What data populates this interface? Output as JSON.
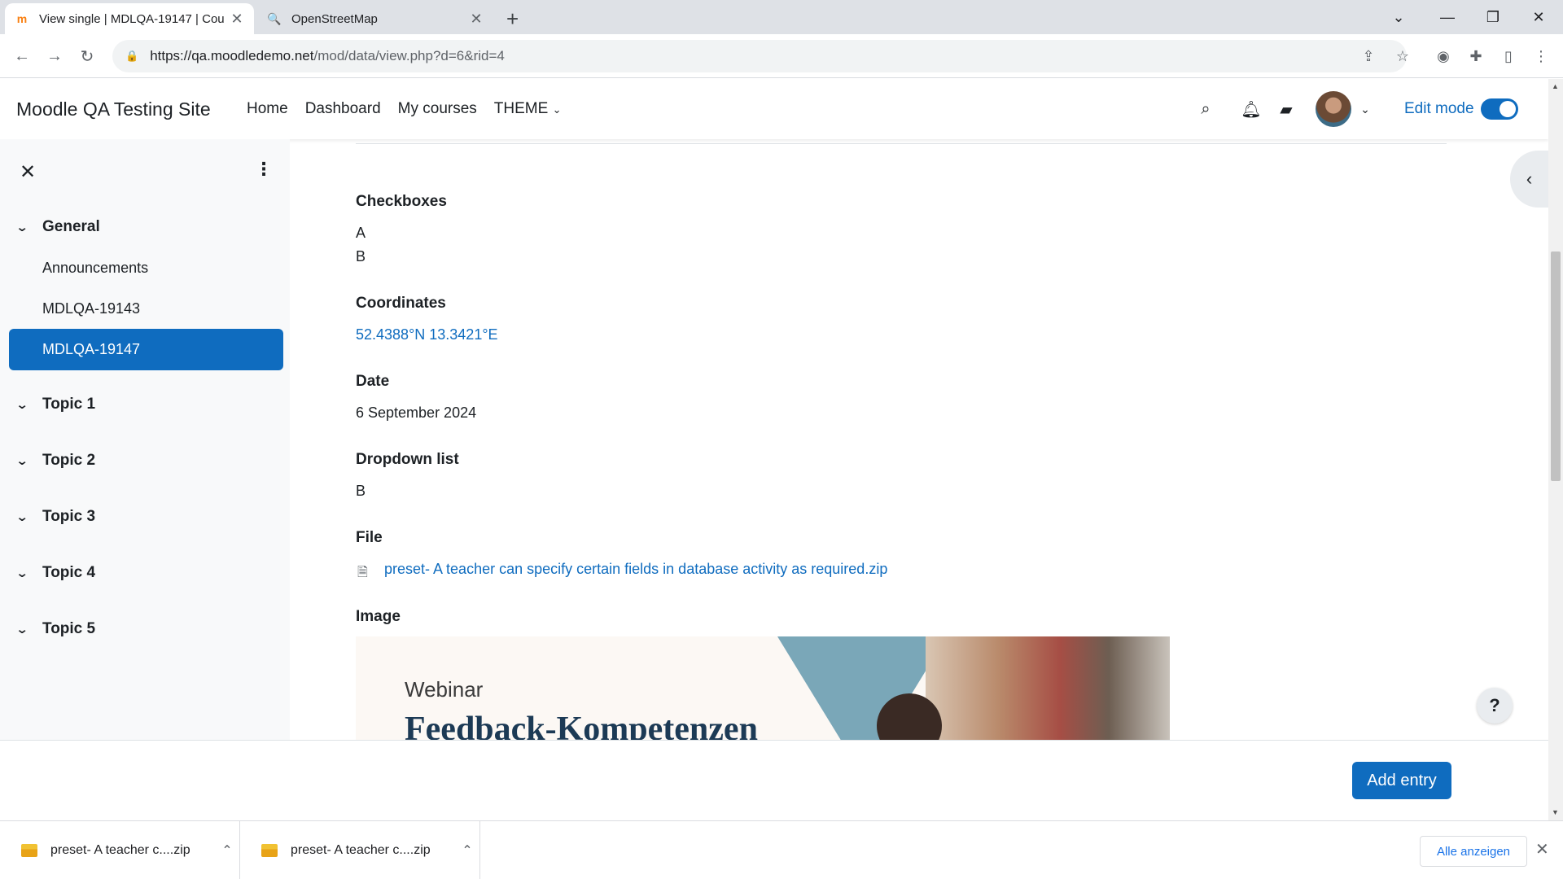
{
  "browser": {
    "tabs": [
      {
        "title": "View single | MDLQA-19147 | Cou",
        "favicon": "moodle-icon",
        "active": true
      },
      {
        "title": "OpenStreetMap",
        "favicon": "openstreetmap-icon",
        "active": false
      }
    ],
    "new_tab_label": "+",
    "url_host": "https://qa.moodledemo.net",
    "url_path": "/mod/data/view.php?d=6&rid=4"
  },
  "moodle": {
    "site_name": "Moodle QA Testing Site",
    "primary_nav": [
      "Home",
      "Dashboard",
      "My courses",
      "THEME"
    ],
    "edit_mode_label": "Edit mode",
    "edit_mode_on": true,
    "accent_color": "#0f6cbf"
  },
  "course_index": {
    "sections": [
      {
        "name": "General",
        "activities": [
          "Announcements",
          "MDLQA-19143",
          "MDLQA-19147"
        ],
        "selected": "MDLQA-19147"
      },
      {
        "name": "Topic 1"
      },
      {
        "name": "Topic 2"
      },
      {
        "name": "Topic 3"
      },
      {
        "name": "Topic 4"
      },
      {
        "name": "Topic 5"
      }
    ]
  },
  "entry": {
    "checkboxes_label": "Checkboxes",
    "checkboxes_values": [
      "A",
      "B"
    ],
    "coordinates_label": "Coordinates",
    "coordinates_value": "52.4388°N 13.3421°E",
    "date_label": "Date",
    "date_value": "6 September 2024",
    "dropdown_label": "Dropdown list",
    "dropdown_value": "B",
    "file_label": "File",
    "file_value": "preset- A teacher can specify certain fields in database activity as required.zip",
    "image_label": "Image",
    "image_text_1": "Webinar",
    "image_text_2": "Feedback-Kompetenzen"
  },
  "footer": {
    "add_entry_label": "Add entry",
    "help_label": "?"
  },
  "downloads": {
    "items": [
      "preset- A teacher c....zip",
      "preset- A teacher c....zip"
    ],
    "show_all_label": "Alle anzeigen"
  }
}
